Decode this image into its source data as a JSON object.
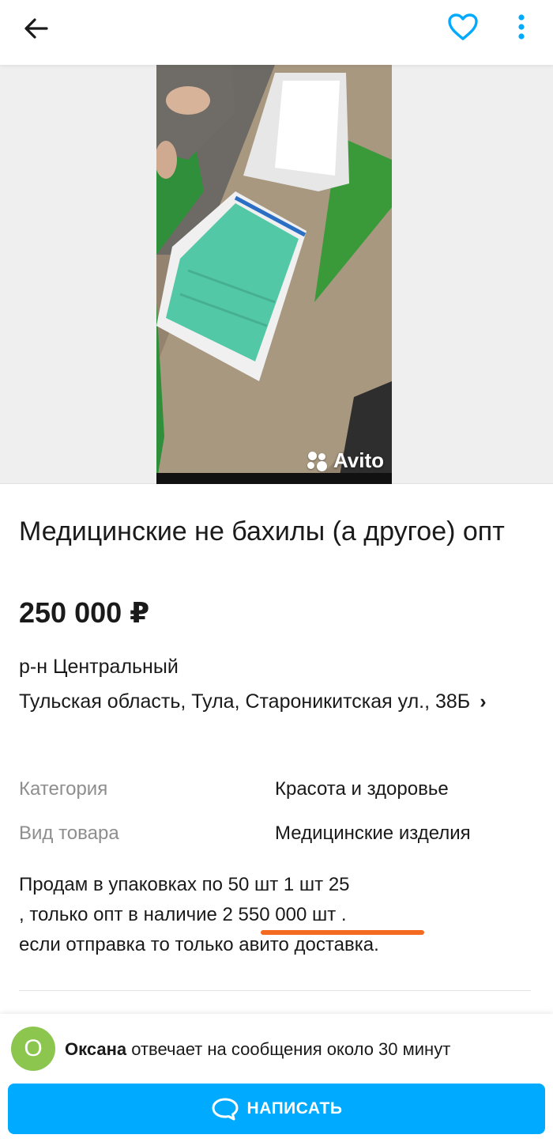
{
  "header": {
    "back_icon": "arrow-left-icon",
    "favorite_icon": "heart-icon",
    "more_icon": "vertical-dots-icon",
    "accent_color": "#00aaff"
  },
  "gallery": {
    "watermark": "Avito"
  },
  "listing": {
    "title": "Медицинские не бахилы (а другое) опт",
    "price": "250 000 ₽"
  },
  "location": {
    "district": "р-н Центральный",
    "address": "Тульская область, Тула, Староникитская ул., 38Б",
    "chevron": "›"
  },
  "params": [
    {
      "label": "Категория",
      "value": "Красота и здоровье"
    },
    {
      "label": "Вид товара",
      "value": "Медицинские изделия"
    }
  ],
  "description": {
    "line1": "Продам в упаковках по 50 шт 1 шт 25",
    "line2": ", только опт в наличие 2 550 000 шт .",
    "line3": "если отправка то только авито доставка.",
    "highlight_color": "#f46a20"
  },
  "seller": {
    "avatar_letter": "О",
    "avatar_color": "#8cc64f",
    "name": "Оксана",
    "response_text": " отвечает на сообщения около 30 минут"
  },
  "actions": {
    "write_label": "НАПИСАТЬ",
    "write_icon": "chat-bubble-icon"
  }
}
